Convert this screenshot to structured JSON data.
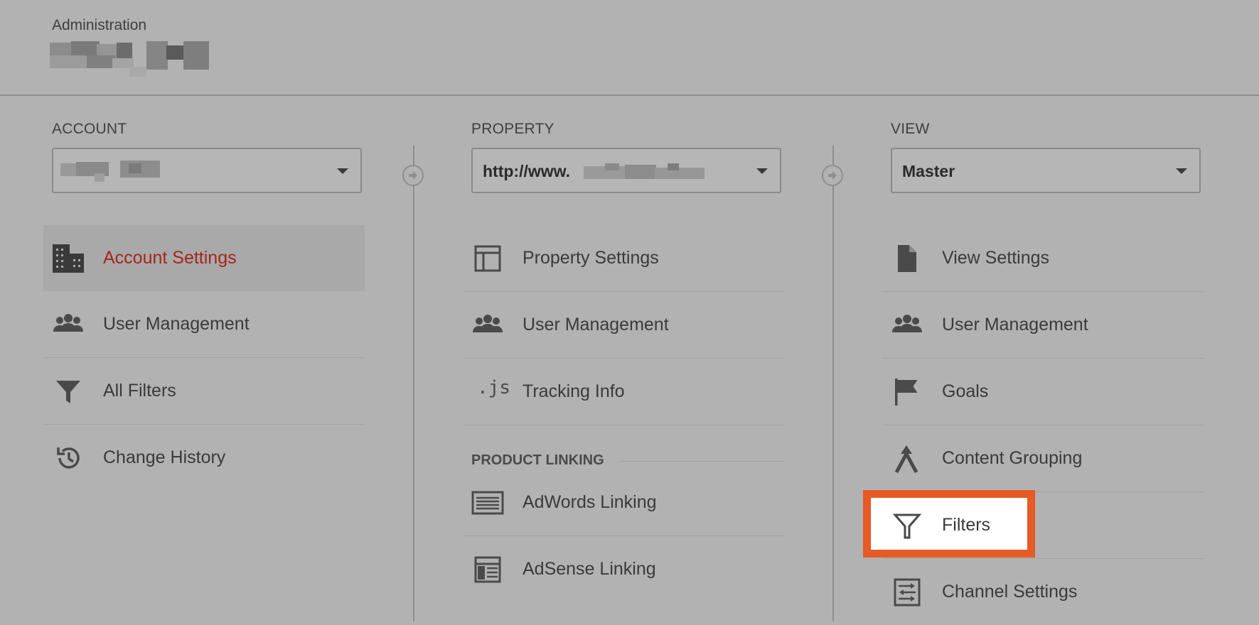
{
  "header": {
    "title": "Administration"
  },
  "account": {
    "label": "ACCOUNT",
    "items": [
      {
        "label": "Account Settings",
        "icon": "building-icon"
      },
      {
        "label": "User Management",
        "icon": "users-icon"
      },
      {
        "label": "All Filters",
        "icon": "filter-icon"
      },
      {
        "label": "Change History",
        "icon": "history-icon"
      }
    ]
  },
  "property": {
    "label": "PROPERTY",
    "selected_prefix": "http://www.",
    "items": [
      {
        "label": "Property Settings",
        "icon": "layout-icon"
      },
      {
        "label": "User Management",
        "icon": "users-icon"
      },
      {
        "label": "Tracking Info",
        "icon": "js-icon",
        "icon_text": ".js"
      }
    ],
    "section_label": "PRODUCT LINKING",
    "linking_items": [
      {
        "label": "AdWords Linking",
        "icon": "adwords-icon"
      },
      {
        "label": "AdSense Linking",
        "icon": "adsense-icon"
      }
    ]
  },
  "view": {
    "label": "VIEW",
    "selected": "Master",
    "items": [
      {
        "label": "View Settings",
        "icon": "document-icon"
      },
      {
        "label": "User Management",
        "icon": "users-icon"
      },
      {
        "label": "Goals",
        "icon": "flag-icon"
      },
      {
        "label": "Content Grouping",
        "icon": "content-grouping-icon"
      },
      {
        "label": "Filters",
        "icon": "filter-icon"
      },
      {
        "label": "Channel Settings",
        "icon": "channel-settings-icon"
      }
    ]
  },
  "colors": {
    "active": "#a3271a",
    "highlight": "#e65a25"
  }
}
